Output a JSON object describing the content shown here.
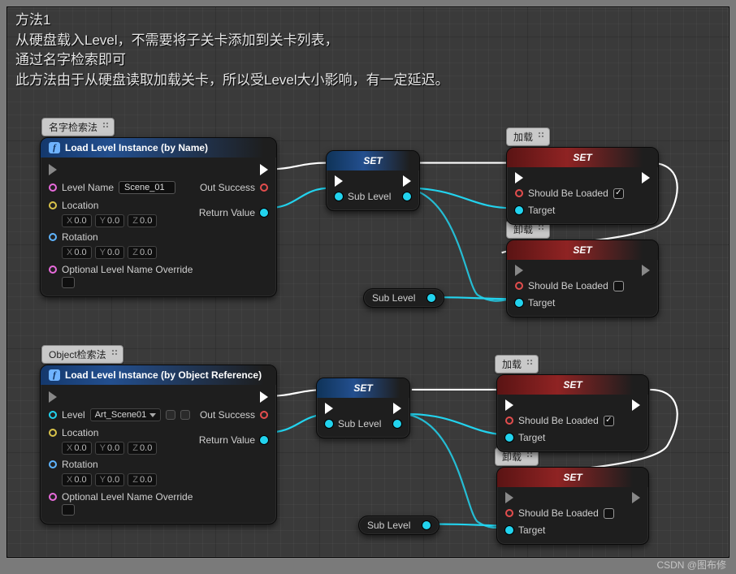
{
  "header": {
    "line1": "方法1",
    "line2": "从硬盘载入Level，不需要将子关卡添加到关卡列表，",
    "line3": "通过名字检索即可",
    "line4": "此方法由于从硬盘读取加载关卡，所以受Level大小影响，有一定延迟。"
  },
  "comments": {
    "c1": "名字检索法",
    "c2": "加载",
    "c3": "卸载",
    "c4": "Object检索法",
    "c5": "加载",
    "c6": "卸载"
  },
  "nodes": {
    "load_by_name": {
      "title": "Load Level Instance (by Name)",
      "level_name_label": "Level Name",
      "level_name_value": "Scene_01",
      "location_label": "Location",
      "rotation_label": "Rotation",
      "override_label": "Optional Level Name Override",
      "out_success": "Out Success",
      "return_value": "Return Value",
      "vec_x": "X",
      "vec_y": "Y",
      "vec_z": "Z",
      "zero": "0.0"
    },
    "load_by_obj": {
      "title": "Load Level Instance (by Object Reference)",
      "level_label": "Level",
      "level_value": "Art_Scene01",
      "location_label": "Location",
      "rotation_label": "Rotation",
      "override_label": "Optional Level Name Override",
      "out_success": "Out Success",
      "return_value": "Return Value"
    },
    "set": {
      "title": "SET",
      "sublevel": "Sub Level"
    },
    "set_loaded": {
      "title": "SET",
      "label": "Should Be Loaded",
      "target": "Target"
    }
  },
  "std": {
    "sublevel": "Sub Level"
  },
  "watermark": "CSDN @图布修"
}
